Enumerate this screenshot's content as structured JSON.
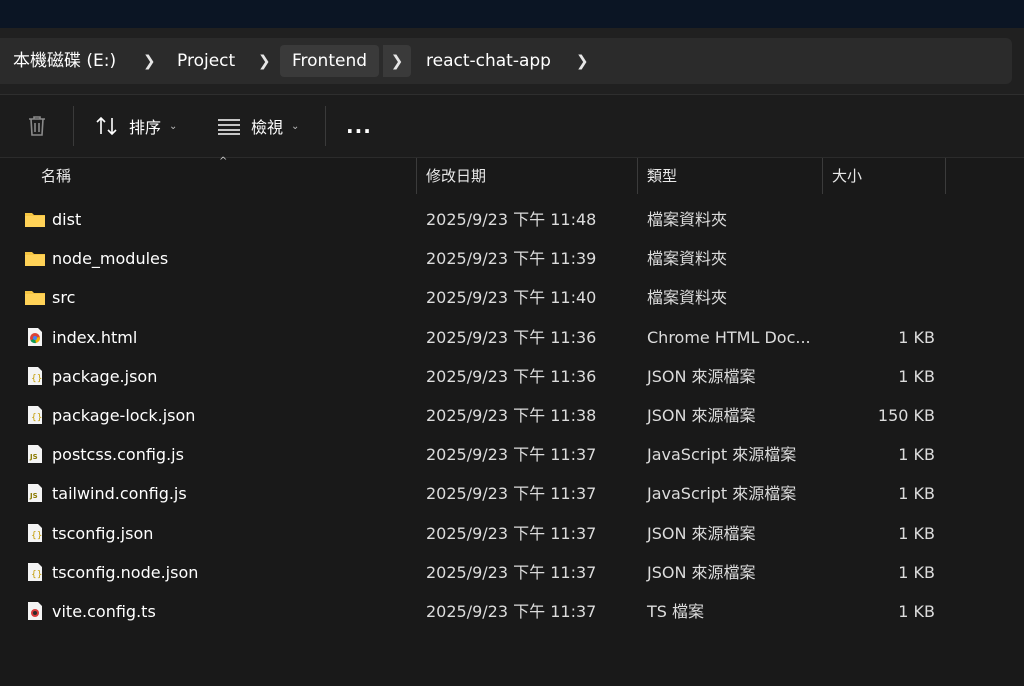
{
  "breadcrumbs": [
    "本機磁碟 (E:)",
    "Project",
    "Frontend",
    "react-chat-app"
  ],
  "toolbar": {
    "sort_label": "排序",
    "view_label": "檢視",
    "more_label": "..."
  },
  "columns": [
    "名稱",
    "修改日期",
    "類型",
    "大小"
  ],
  "files": [
    {
      "name": "dist",
      "date": "2025/9/23 下午 11:48",
      "type": "檔案資料夾",
      "size": "",
      "icon": "folder-icon"
    },
    {
      "name": "node_modules",
      "date": "2025/9/23 下午 11:39",
      "type": "檔案資料夾",
      "size": "",
      "icon": "folder-icon"
    },
    {
      "name": "src",
      "date": "2025/9/23 下午 11:40",
      "type": "檔案資料夾",
      "size": "",
      "icon": "folder-icon"
    },
    {
      "name": "index.html",
      "date": "2025/9/23 下午 11:36",
      "type": "Chrome HTML Doc...",
      "size": "1 KB",
      "icon": "chrome-html-icon"
    },
    {
      "name": "package.json",
      "date": "2025/9/23 下午 11:36",
      "type": "JSON 來源檔案",
      "size": "1 KB",
      "icon": "json-file-icon"
    },
    {
      "name": "package-lock.json",
      "date": "2025/9/23 下午 11:38",
      "type": "JSON 來源檔案",
      "size": "150 KB",
      "icon": "json-file-icon"
    },
    {
      "name": "postcss.config.js",
      "date": "2025/9/23 下午 11:37",
      "type": "JavaScript 來源檔案",
      "size": "1 KB",
      "icon": "js-file-icon"
    },
    {
      "name": "tailwind.config.js",
      "date": "2025/9/23 下午 11:37",
      "type": "JavaScript 來源檔案",
      "size": "1 KB",
      "icon": "js-file-icon"
    },
    {
      "name": "tsconfig.json",
      "date": "2025/9/23 下午 11:37",
      "type": "JSON 來源檔案",
      "size": "1 KB",
      "icon": "json-file-icon"
    },
    {
      "name": "tsconfig.node.json",
      "date": "2025/9/23 下午 11:37",
      "type": "JSON 來源檔案",
      "size": "1 KB",
      "icon": "json-file-icon"
    },
    {
      "name": "vite.config.ts",
      "date": "2025/9/23 下午 11:37",
      "type": "TS 檔案",
      "size": "1 KB",
      "icon": "ts-file-icon"
    }
  ],
  "colors": {
    "folder": "#f5c542",
    "background": "#191919",
    "accent": "#4cc2ff"
  }
}
